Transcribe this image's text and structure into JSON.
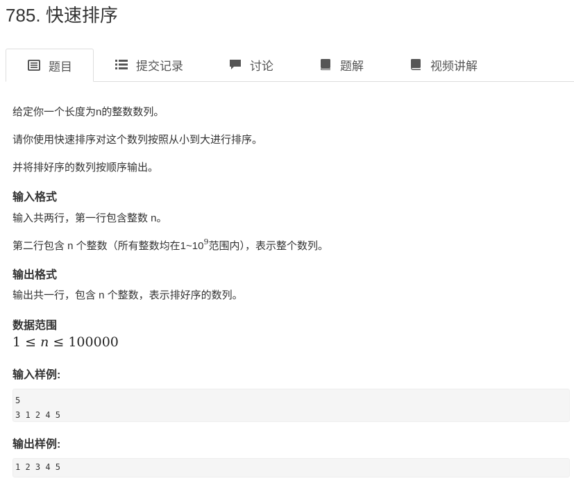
{
  "problem": {
    "title": "785. 快速排序"
  },
  "tabs": [
    {
      "label": "题目",
      "icon": "list-icon",
      "active": true
    },
    {
      "label": "提交记录",
      "icon": "list-bullets-icon",
      "active": false
    },
    {
      "label": "讨论",
      "icon": "comment-icon",
      "active": false
    },
    {
      "label": "题解",
      "icon": "book-icon",
      "active": false
    },
    {
      "label": "视频讲解",
      "icon": "book-icon",
      "active": false
    }
  ],
  "description": {
    "line1": "给定你一个长度为n的整数数列。",
    "line2": "请你使用快速排序对这个数列按照从小到大进行排序。",
    "line3": "并将排好序的数列按顺序输出。"
  },
  "input_format": {
    "heading": "输入格式",
    "line1": "输入共两行，第一行包含整数 n。",
    "line2_prefix": "第二行包含 n 个整数（所有整数均在1~10",
    "line2_sup": "9",
    "line2_suffix": "范围内），表示整个数列。"
  },
  "output_format": {
    "heading": "输出格式",
    "line1": "输出共一行，包含 n 个整数，表示排好序的数列。"
  },
  "data_range": {
    "heading": "数据范围",
    "formula_left": "1 ≤ ",
    "formula_var": "n",
    "formula_right": " ≤ 100000"
  },
  "sample_input": {
    "heading": "输入样例:",
    "text": "5\n3 1 2 4 5"
  },
  "sample_output": {
    "heading": "输出样例:",
    "text": "1 2 3 4 5"
  }
}
